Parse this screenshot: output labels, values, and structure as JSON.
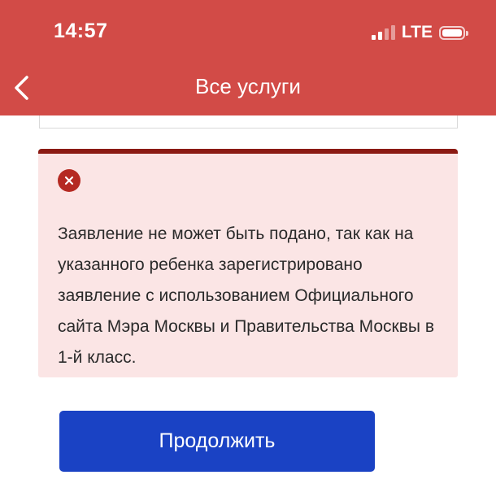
{
  "status_bar": {
    "time": "14:57",
    "network": "LTE",
    "signal_bars_active": 2,
    "signal_bars_total": 4,
    "battery_icon": "battery-full-icon"
  },
  "nav": {
    "back_icon": "chevron-left-icon",
    "title": "Все услуги"
  },
  "alert": {
    "type": "error",
    "icon": "error-x-circle-icon",
    "message": "Заявление не может быть подано, так как на указанного ребенка зарегистрировано заявление с использованием Официального сайта Мэра Москвы и Правительства Москвы в 1-й класс."
  },
  "actions": {
    "continue_label": "Продолжить"
  },
  "colors": {
    "header_bg": "#d24b47",
    "alert_bg": "#fbe5e5",
    "alert_border": "#8b1a13",
    "error_icon": "#b52a22",
    "primary_button": "#1a42c4"
  }
}
